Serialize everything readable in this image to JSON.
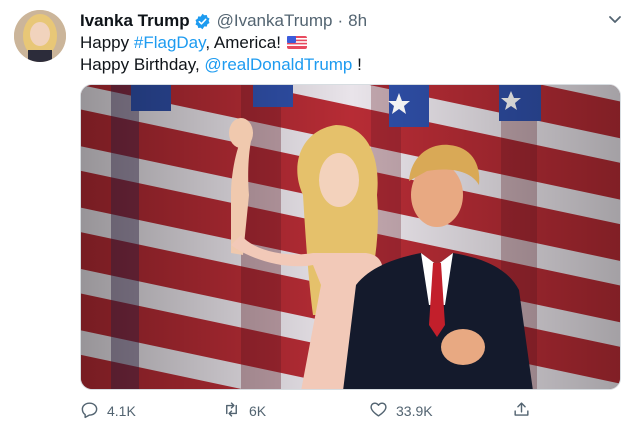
{
  "tweet": {
    "author_name": "Ivanka Trump",
    "handle": "@IvankaTrump",
    "separator": "·",
    "time": "8h",
    "text_line1": {
      "before": "Happy ",
      "hashtag": "#FlagDay",
      "after": ", America!"
    },
    "text_line2": {
      "before": "Happy Birthday, ",
      "mention": "@realDonaldTrump",
      "after": " !"
    },
    "icons": {
      "verified": "verified-badge-icon",
      "more": "chevron-down-icon",
      "flag": "us-flag-emoji"
    }
  },
  "actions": {
    "reply_count": "4.1K",
    "retweet_count": "6K",
    "like_count": "33.9K"
  },
  "colors": {
    "link": "#1d9bf0",
    "muted": "#536471",
    "verified": "#1d9bf0"
  }
}
